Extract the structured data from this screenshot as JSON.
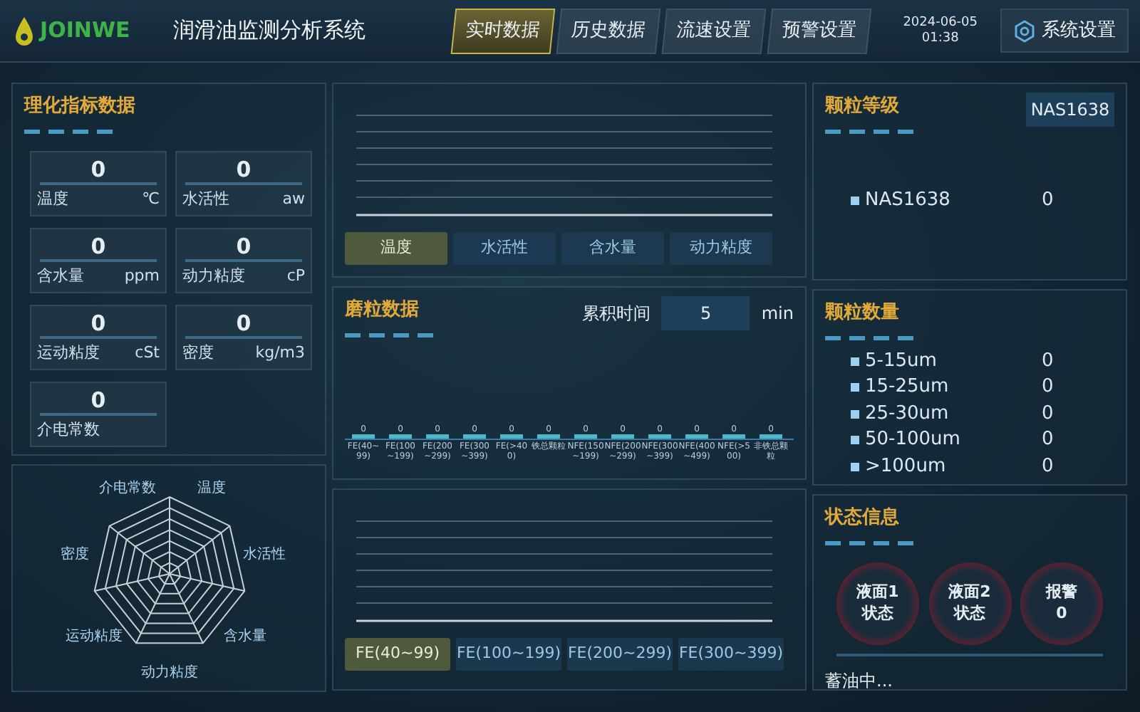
{
  "header": {
    "logo_text": "JOINWE",
    "title": "润滑油监测分析系统",
    "nav": [
      {
        "label": "实时数据",
        "selected": true
      },
      {
        "label": "历史数据",
        "selected": false
      },
      {
        "label": "流速设置",
        "selected": false
      },
      {
        "label": "预警设置",
        "selected": false
      }
    ],
    "date": "2024-06-05",
    "time": "01:38",
    "settings": "系统设置"
  },
  "indicators": {
    "title": "理化指标数据",
    "items": [
      {
        "reading": "0",
        "label": "温度",
        "unit": "℃"
      },
      {
        "reading": "0",
        "label": "水活性",
        "unit": "aw"
      },
      {
        "reading": "0",
        "label": "含水量",
        "unit": "ppm"
      },
      {
        "reading": "0",
        "label": "动力粘度",
        "unit": "cP"
      },
      {
        "reading": "0",
        "label": "运动粘度",
        "unit": "cSt"
      },
      {
        "reading": "0",
        "label": "密度",
        "unit": "kg/m3"
      },
      {
        "reading": "0",
        "label": "介电常数"
      }
    ]
  },
  "radar": {
    "axes": [
      "介电常数",
      "温度",
      "密度",
      "水活性",
      "运动粘度",
      "含水量",
      "动力粘度"
    ]
  },
  "trend": {
    "tabs": [
      {
        "label": "温度",
        "selected": true
      },
      {
        "label": "水活性",
        "selected": false
      },
      {
        "label": "含水量",
        "selected": false
      },
      {
        "label": "动力粘度",
        "selected": false
      }
    ]
  },
  "wear": {
    "title": "磨粒数据",
    "time_label": "累积时间",
    "time_value": "5",
    "time_unit": "min",
    "bars": [
      {
        "label": "FE(40~99)",
        "value": "0"
      },
      {
        "label": "FE(100~199)",
        "value": "0"
      },
      {
        "label": "FE(200~299)",
        "value": "0"
      },
      {
        "label": "FE(300~399)",
        "value": "0"
      },
      {
        "label": "FE(>400)",
        "value": "0"
      },
      {
        "label": "铁总颗粒",
        "value": "0"
      },
      {
        "label": "NFE(150~199)",
        "value": "0"
      },
      {
        "label": "NFE(200~299)",
        "value": "0"
      },
      {
        "label": "NFE(300~399)",
        "value": "0"
      },
      {
        "label": "NFE(400~499)",
        "value": "0"
      },
      {
        "label": "NFE(>500)",
        "value": "0"
      },
      {
        "label": "非铁总颗粒",
        "value": "0"
      }
    ]
  },
  "wear_trend": {
    "tabs": [
      {
        "label": "FE(40~99)",
        "selected": true
      },
      {
        "label": "FE(100~199)",
        "selected": false
      },
      {
        "label": "FE(200~299)",
        "selected": false
      },
      {
        "label": "FE(300~399)",
        "selected": false
      }
    ]
  },
  "grade": {
    "title": "颗粒等级",
    "standard": "NAS1638",
    "rows": [
      {
        "label": "NAS1638",
        "value": "0"
      }
    ]
  },
  "count": {
    "title": "颗粒数量",
    "rows": [
      {
        "label": "5-15um",
        "value": "0"
      },
      {
        "label": "15-25um",
        "value": "0"
      },
      {
        "label": "25-30um",
        "value": "0"
      },
      {
        "label": "50-100um",
        "value": "0"
      },
      {
        "label": ">100um",
        "value": "0"
      }
    ]
  },
  "status": {
    "title": "状态信息",
    "indicators": [
      {
        "lines": [
          "液面1",
          "状态"
        ]
      },
      {
        "lines": [
          "液面2",
          "状态"
        ]
      },
      {
        "lines": [
          "报警",
          "0"
        ]
      }
    ],
    "message": "蓄油中..."
  }
}
